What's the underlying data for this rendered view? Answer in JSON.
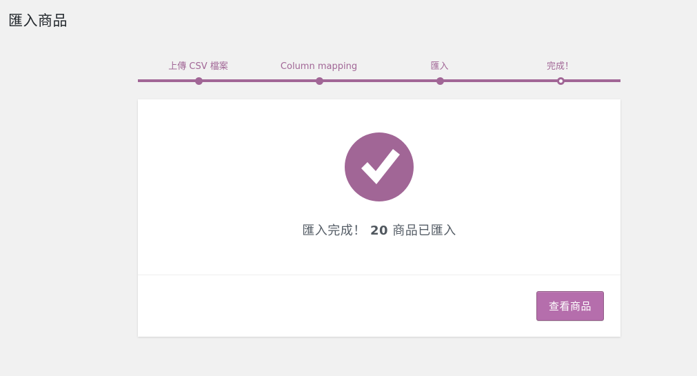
{
  "page": {
    "title": "匯入商品"
  },
  "steps": [
    {
      "label": "上傳 CSV 檔案",
      "state": "done"
    },
    {
      "label": "Column mapping",
      "state": "done"
    },
    {
      "label": "匯入",
      "state": "done"
    },
    {
      "label": "完成！",
      "state": "current"
    }
  ],
  "result": {
    "icon": "checkmark-icon",
    "message_prefix": "匯入完成！",
    "count": "20",
    "message_suffix": "商品已匯入"
  },
  "actions": {
    "view_products_label": "查看商品"
  },
  "colors": {
    "accent": "#a16696",
    "button": "#b56eac",
    "background": "#f1f1f1"
  }
}
